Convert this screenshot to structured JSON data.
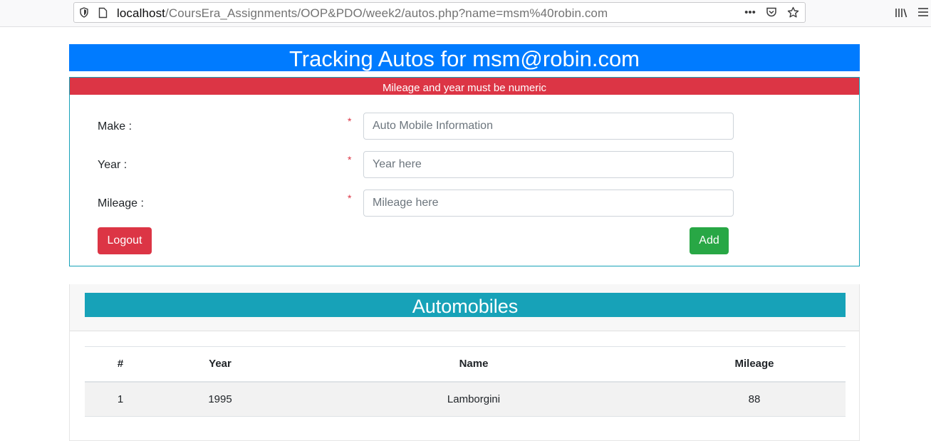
{
  "browser": {
    "url_host": "localhost",
    "url_path": "/CoursEra_Assignments/OOP&PDO/week2/autos.php?name=msm%40robin.com",
    "more_glyph": "•••"
  },
  "page": {
    "title": "Tracking Autos for msm@robin.com",
    "alert": "Mileage and year must be numeric"
  },
  "form": {
    "make_label": "Make :",
    "make_placeholder": "Auto Mobile Information",
    "year_label": "Year :",
    "year_placeholder": "Year here",
    "mileage_label": "Mileage :",
    "mileage_placeholder": "Mileage here",
    "required_mark": "*",
    "logout_label": "Logout",
    "add_label": "Add"
  },
  "automobiles": {
    "title": "Automobiles",
    "columns": [
      "#",
      "Year",
      "Name",
      "Mileage"
    ],
    "rows": [
      [
        "1",
        "1995",
        "Lamborgini",
        "88"
      ]
    ]
  },
  "colors": {
    "primary": "#007bff",
    "danger": "#dc3545",
    "success": "#28a745",
    "info": "#17a2b8"
  }
}
